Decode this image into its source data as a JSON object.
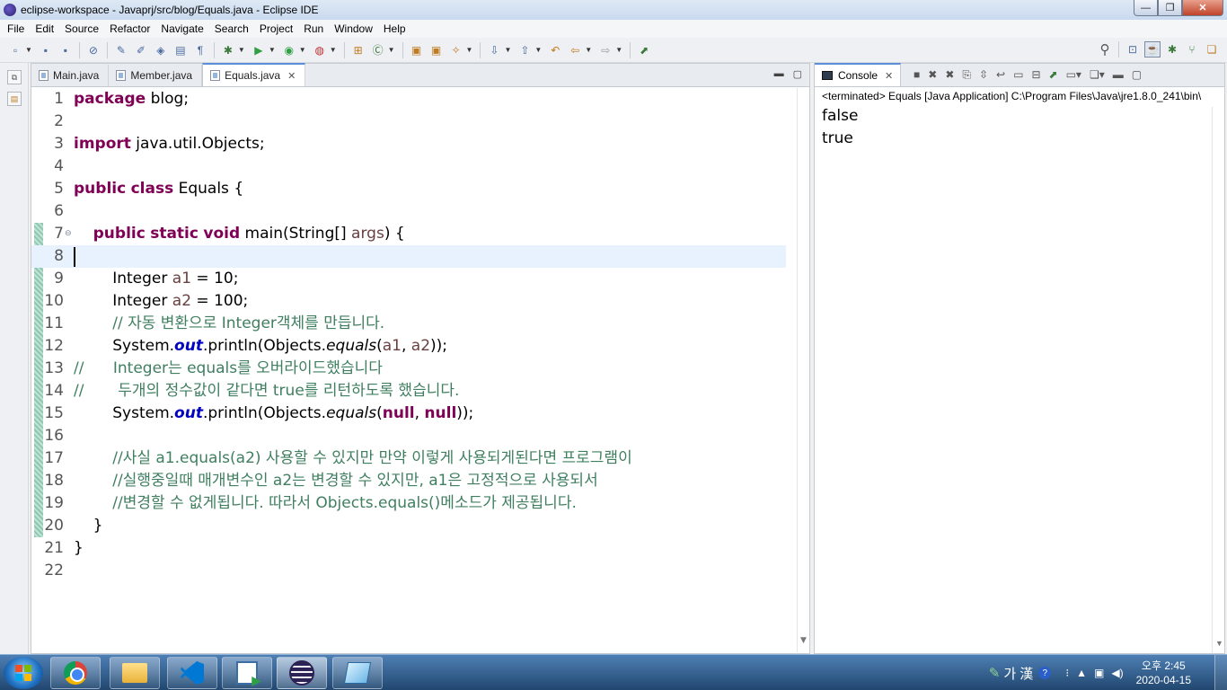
{
  "window": {
    "title": "eclipse-workspace - Javaprj/src/blog/Equals.java - Eclipse IDE",
    "controls": [
      "—",
      "❐",
      "✕"
    ]
  },
  "menu": [
    "File",
    "Edit",
    "Source",
    "Refactor",
    "Navigate",
    "Search",
    "Project",
    "Run",
    "Window",
    "Help"
  ],
  "editor": {
    "tabs": [
      {
        "label": "Main.java",
        "active": false
      },
      {
        "label": "Member.java",
        "active": false
      },
      {
        "label": "Equals.java",
        "active": true
      }
    ],
    "current_line": 8,
    "lines": [
      {
        "n": "1",
        "tokens": [
          {
            "t": "package",
            "c": "kw"
          },
          {
            "t": " blog;"
          }
        ]
      },
      {
        "n": "2",
        "tokens": []
      },
      {
        "n": "3",
        "tokens": [
          {
            "t": "import",
            "c": "kw"
          },
          {
            "t": " java.util.Objects;"
          }
        ]
      },
      {
        "n": "4",
        "tokens": []
      },
      {
        "n": "5",
        "tokens": [
          {
            "t": "public",
            "c": "kw"
          },
          {
            "t": " "
          },
          {
            "t": "class",
            "c": "kw"
          },
          {
            "t": " Equals {"
          }
        ]
      },
      {
        "n": "6",
        "tokens": []
      },
      {
        "n": "7",
        "fold": true,
        "tokens": [
          {
            "t": "    "
          },
          {
            "t": "public",
            "c": "kw"
          },
          {
            "t": " "
          },
          {
            "t": "static",
            "c": "kw"
          },
          {
            "t": " "
          },
          {
            "t": "void",
            "c": "kw"
          },
          {
            "t": " main(String[] "
          },
          {
            "t": "args",
            "c": "var"
          },
          {
            "t": ") {"
          }
        ]
      },
      {
        "n": "8",
        "tokens": []
      },
      {
        "n": "9",
        "tokens": [
          {
            "t": "        Integer "
          },
          {
            "t": "a1",
            "c": "var"
          },
          {
            "t": " = 10;"
          }
        ]
      },
      {
        "n": "10",
        "tokens": [
          {
            "t": "        Integer "
          },
          {
            "t": "a2",
            "c": "var"
          },
          {
            "t": " = 100;"
          }
        ]
      },
      {
        "n": "11",
        "tokens": [
          {
            "t": "        "
          },
          {
            "t": "// 자동 변환으로 Integer객체를 만듭니다.",
            "c": "cm"
          }
        ]
      },
      {
        "n": "12",
        "tokens": [
          {
            "t": "        System."
          },
          {
            "t": "out",
            "c": "fld"
          },
          {
            "t": ".println(Objects."
          },
          {
            "t": "equals",
            "c": "itc"
          },
          {
            "t": "("
          },
          {
            "t": "a1",
            "c": "var"
          },
          {
            "t": ", "
          },
          {
            "t": "a2",
            "c": "var"
          },
          {
            "t": "));"
          }
        ]
      },
      {
        "n": "13",
        "tokens": [
          {
            "t": "//      Integer는 equals를 오버라이드했습니다",
            "c": "cm"
          }
        ]
      },
      {
        "n": "14",
        "tokens": [
          {
            "t": "//       두개의 정수값이 같다면 true를 리턴하도록 했습니다.",
            "c": "cm"
          }
        ]
      },
      {
        "n": "15",
        "tokens": [
          {
            "t": "        System."
          },
          {
            "t": "out",
            "c": "fld"
          },
          {
            "t": ".println(Objects."
          },
          {
            "t": "equals",
            "c": "itc"
          },
          {
            "t": "("
          },
          {
            "t": "null",
            "c": "kw"
          },
          {
            "t": ", "
          },
          {
            "t": "null",
            "c": "kw"
          },
          {
            "t": "));"
          }
        ]
      },
      {
        "n": "16",
        "tokens": []
      },
      {
        "n": "17",
        "tokens": [
          {
            "t": "        "
          },
          {
            "t": "//사실 a1.equals(a2) 사용할 수 있지만 만약 이렇게 사용되게된다면 프로그램이",
            "c": "cm"
          }
        ]
      },
      {
        "n": "18",
        "tokens": [
          {
            "t": "        "
          },
          {
            "t": "//실행중일때 매개변수인 a2는 변경할 수 있지만, a1은 고정적으로 사용되서",
            "c": "cm"
          }
        ]
      },
      {
        "n": "19",
        "tokens": [
          {
            "t": "        "
          },
          {
            "t": "//변경할 수 없게됩니다. 따라서 Objects.equals()메소드가 제공됩니다.",
            "c": "cm"
          }
        ]
      },
      {
        "n": "20",
        "tokens": [
          {
            "t": "    }"
          }
        ]
      },
      {
        "n": "21",
        "tokens": [
          {
            "t": "}"
          }
        ]
      },
      {
        "n": "22",
        "tokens": []
      }
    ]
  },
  "console": {
    "tab_label": "Console",
    "status": "<terminated> Equals [Java Application] C:\\Program Files\\Java\\jre1.8.0_241\\bin\\",
    "output": [
      "false",
      "true"
    ]
  },
  "taskbar": {
    "ime_text": "가 漢",
    "clock_time": "오후 2:45",
    "clock_date": "2020-04-15"
  },
  "colors": {
    "keyword": "#7f0055",
    "comment": "#3f7f5f",
    "field": "#0000c0",
    "current_line": "#e8f2fe"
  }
}
